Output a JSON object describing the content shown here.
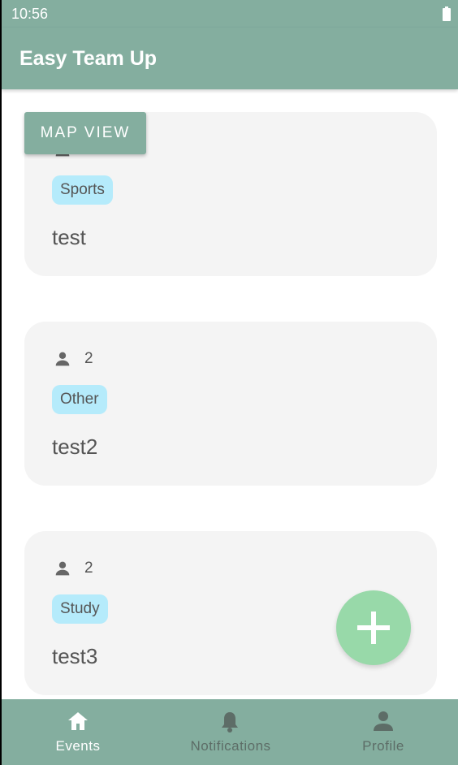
{
  "status_bar": {
    "time": "10:56",
    "battery_icon": "battery-icon"
  },
  "app_bar": {
    "title": "Easy Team Up"
  },
  "map_view_button": {
    "label": "MAP VIEW"
  },
  "events": [
    {
      "participants": "",
      "category": "Sports",
      "title": "test"
    },
    {
      "participants": "2",
      "category": "Other",
      "title": "test2"
    },
    {
      "participants": "2",
      "category": "Study",
      "title": "test3"
    }
  ],
  "fab": {
    "icon": "plus-icon"
  },
  "bottom_nav": [
    {
      "label": "Events",
      "icon": "home-icon",
      "active": true
    },
    {
      "label": "Notifications",
      "icon": "bell-icon",
      "active": false
    },
    {
      "label": "Profile",
      "icon": "person-icon",
      "active": false
    }
  ],
  "colors": {
    "primary": "#84ae9f",
    "card": "#f4f4f4",
    "chip": "#b5ebfb",
    "fab": "#98d9a9",
    "text": "#555555"
  }
}
